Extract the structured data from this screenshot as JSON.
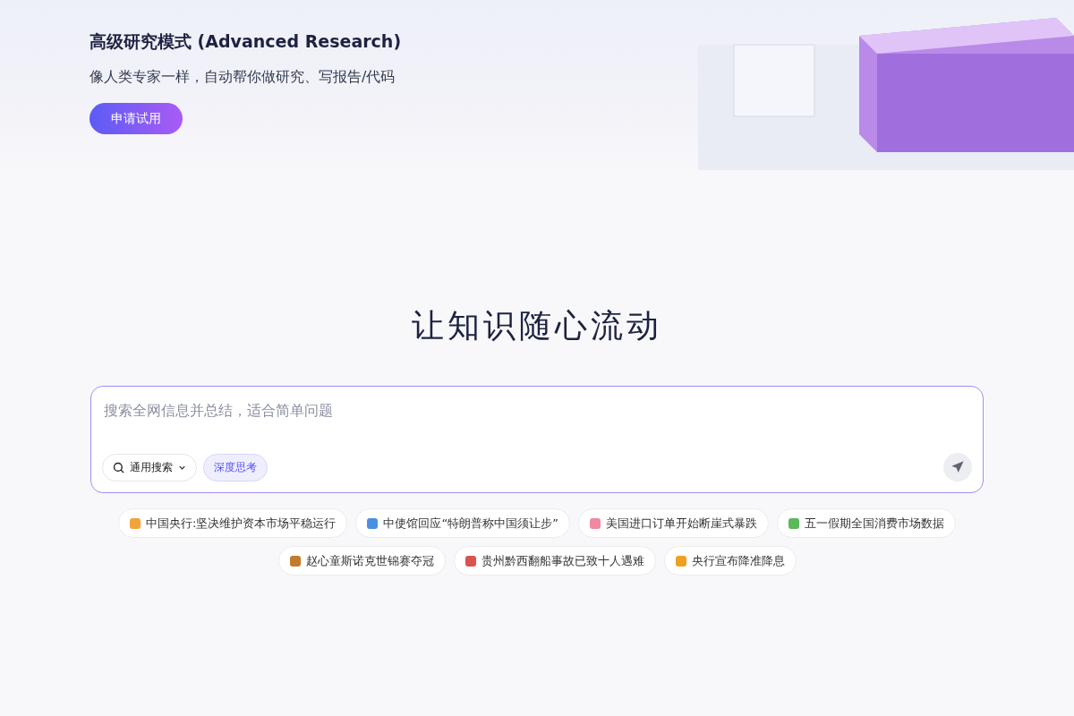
{
  "banner": {
    "title": "高级研究模式 (Advanced Research)",
    "subtitle": "像人类专家一样，自动帮你做研究、写报告/代码",
    "button": "申请试用"
  },
  "headline": "让知识随心流动",
  "search": {
    "placeholder": "搜索全网信息并总结，适合简单问题",
    "mode": "通用搜索",
    "toggles": [
      {
        "label": "深度思考",
        "selected": true
      }
    ]
  },
  "topics": [
    {
      "label": "中国央行:坚决维护资本市场平稳运行",
      "color": "#f2a33a"
    },
    {
      "label": "中使馆回应“特朗普称中国须让步”",
      "color": "#4a90e2"
    },
    {
      "label": "美国进口订单开始断崖式暴跌",
      "color": "#f08aa0"
    },
    {
      "label": "五一假期全国消费市场数据",
      "color": "#5bb85b"
    },
    {
      "label": "赵心童斯诺克世锦赛夺冠",
      "color": "#c27a2c"
    },
    {
      "label": "贵州黔西翻船事故已致十人遇难",
      "color": "#d9534f"
    },
    {
      "label": "央行宣布降准降息",
      "color": "#f0a020"
    }
  ]
}
